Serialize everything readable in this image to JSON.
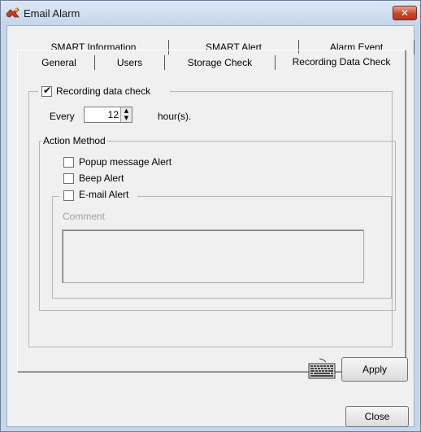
{
  "window": {
    "title": "Email Alarm",
    "close_glyph": "✕"
  },
  "tabs": {
    "row1": [
      {
        "label": "SMART Information"
      },
      {
        "label": "SMART Alert"
      },
      {
        "label": "Alarm Event"
      }
    ],
    "row2": [
      {
        "label": "General"
      },
      {
        "label": "Users"
      },
      {
        "label": "Storage Check"
      },
      {
        "label": "Recording Data Check",
        "active": true
      }
    ]
  },
  "recording_check": {
    "label": "Recording data check",
    "checked": true,
    "check_glyph": "✔",
    "every_label": "Every",
    "interval_value": "12",
    "unit_label": "hour(s).",
    "spin_up": "▲",
    "spin_down": "▼"
  },
  "action_method": {
    "legend": "Action Method",
    "popup_label": "Popup message Alert",
    "beep_label": "Beep Alert",
    "email_label": "E-mail Alert",
    "comment_label": "Comment",
    "comment_value": ""
  },
  "buttons": {
    "apply": "Apply",
    "close": "Close"
  },
  "icons": {
    "app": "email-alarm-app-icon",
    "keyboard": "keyboard-icon"
  },
  "colors": {
    "title_bg": "#c4d6ec",
    "close_btn": "#c6452c",
    "dialog_bg": "#f0f0f0"
  }
}
